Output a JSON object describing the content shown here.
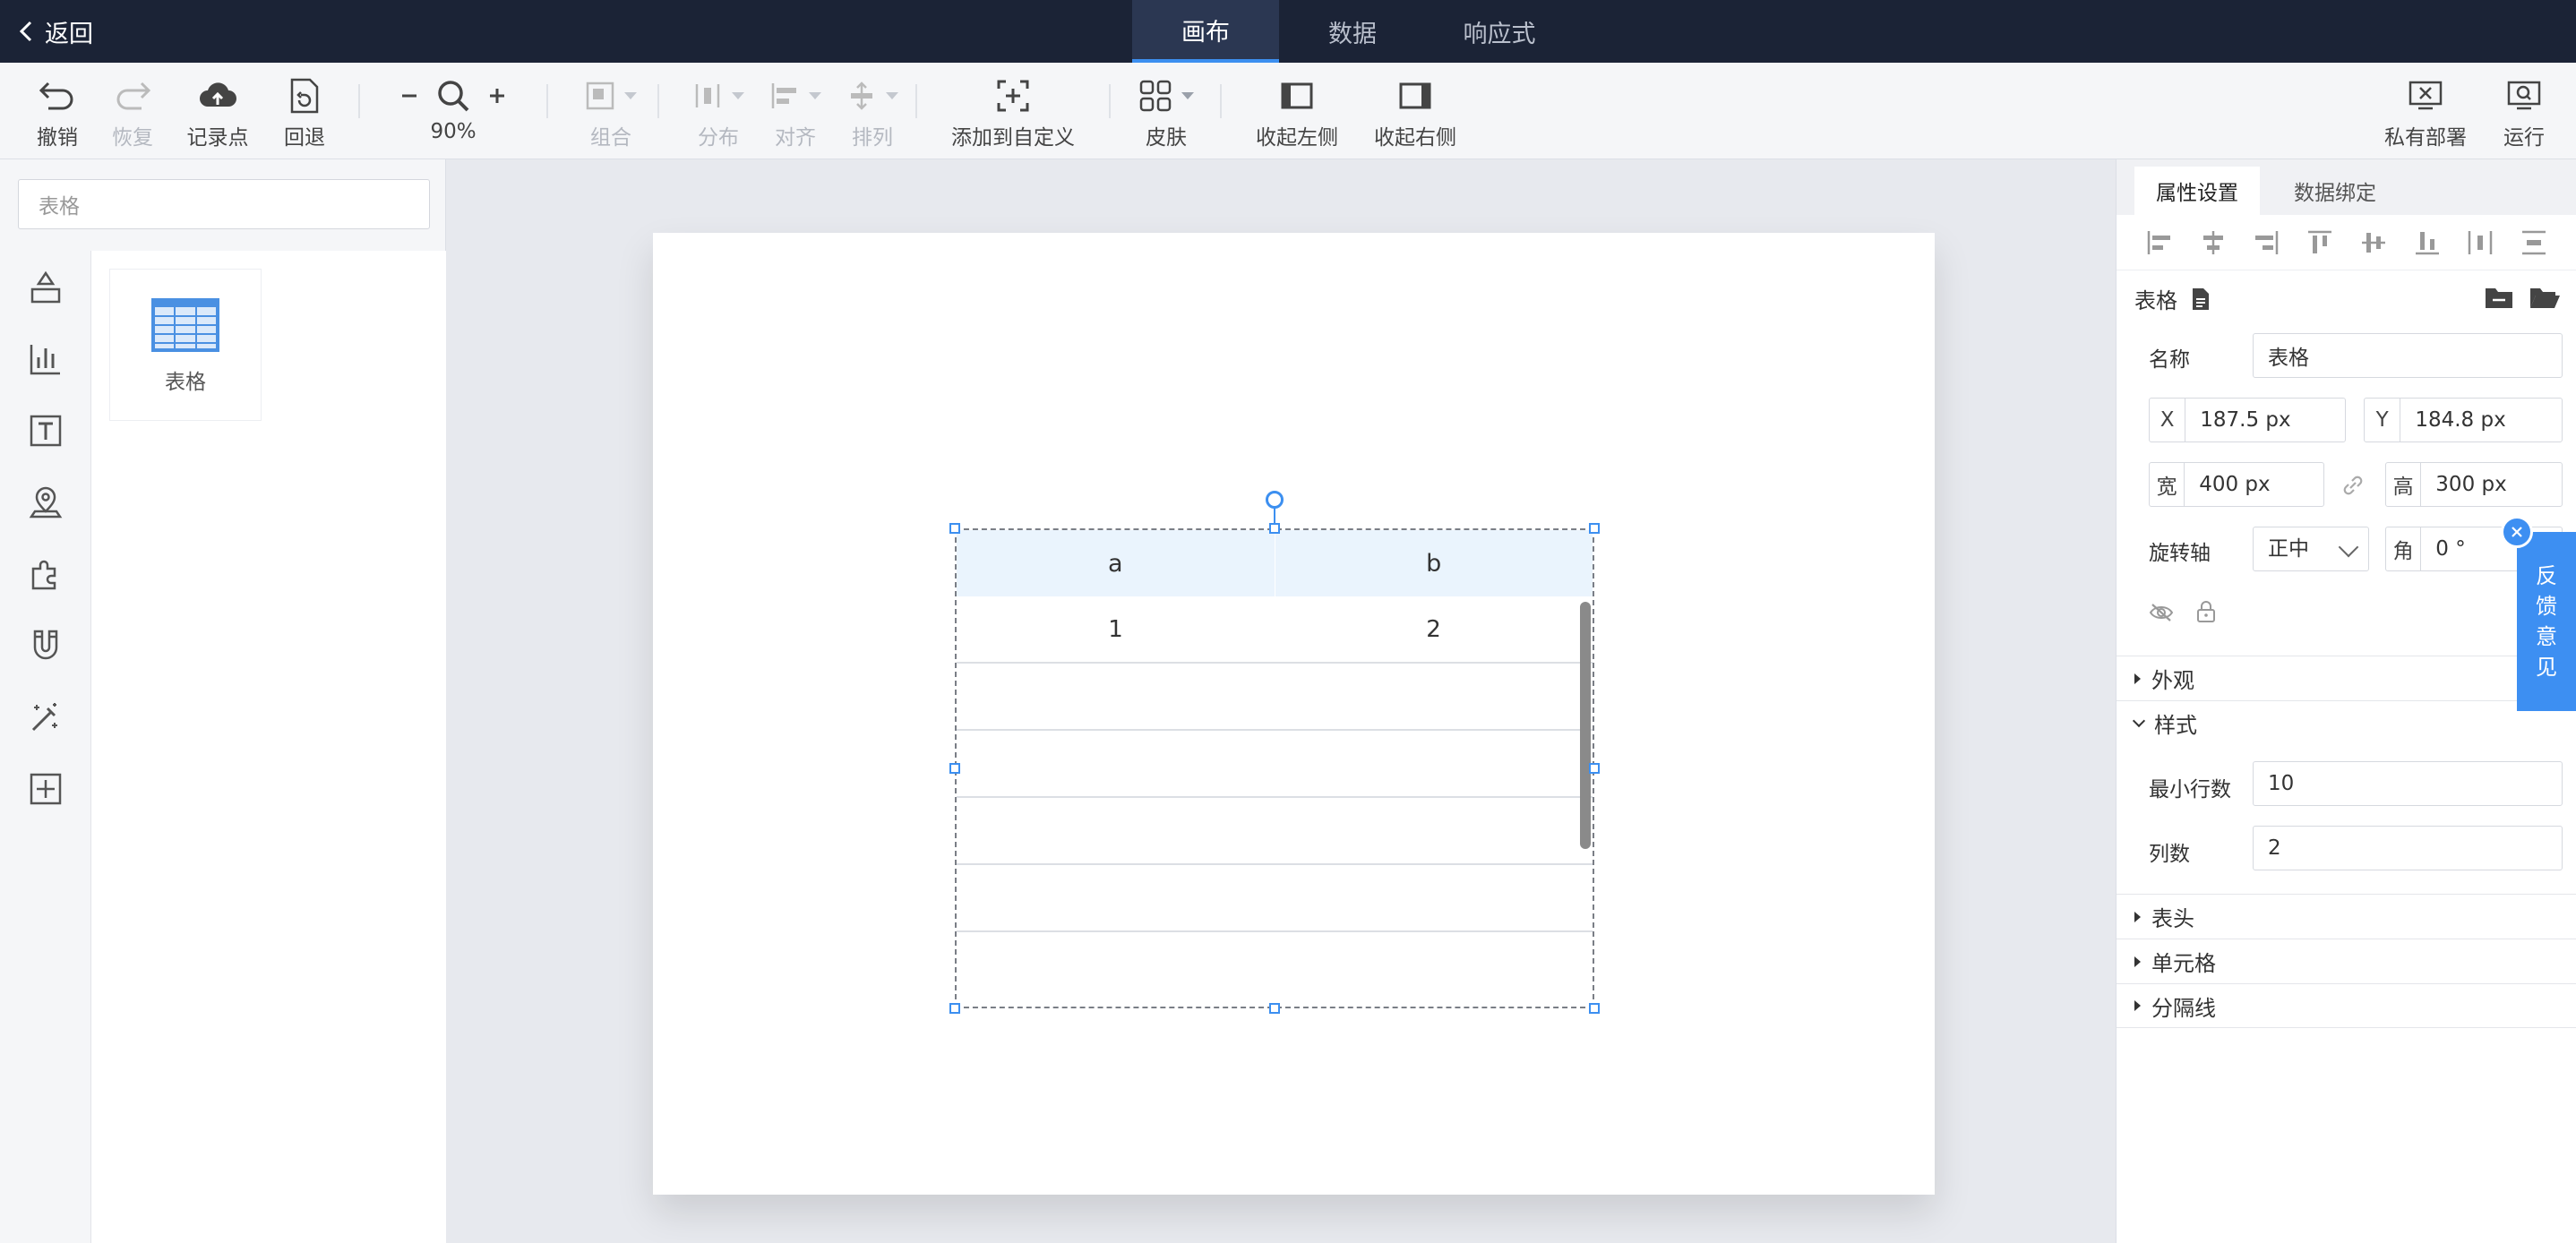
{
  "topbar": {
    "back_label": "返回",
    "tabs": [
      {
        "label": "画布",
        "active": true
      },
      {
        "label": "数据",
        "active": false
      },
      {
        "label": "响应式",
        "active": false
      }
    ]
  },
  "toolbar": {
    "undo": "撤销",
    "redo": "恢复",
    "record_point": "记录点",
    "rollback": "回退",
    "zoom": "90%",
    "group": "组合",
    "distribute": "分布",
    "align": "对齐",
    "arrange": "排列",
    "add_custom": "添加到自定义",
    "skin": "皮肤",
    "collapse_left": "收起左侧",
    "collapse_right": "收起右侧",
    "private_deploy": "私有部署",
    "run": "运行"
  },
  "left": {
    "search_value": "表格",
    "components": [
      {
        "label": "表格",
        "icon": "table-icon"
      }
    ],
    "rail_icons": [
      "shapes-icon",
      "bar-chart-icon",
      "text-icon",
      "map-pin-icon",
      "puzzle-icon",
      "magnet-icon",
      "magic-wand-icon",
      "add-frame-icon"
    ]
  },
  "canvas": {
    "table": {
      "headers": [
        "a",
        "b"
      ],
      "rows": [
        [
          "1",
          "2"
        ],
        [
          "",
          ""
        ],
        [
          "",
          ""
        ],
        [
          "",
          ""
        ],
        [
          "",
          ""
        ],
        [
          "",
          ""
        ]
      ]
    }
  },
  "right": {
    "tabs": [
      "属性设置",
      "数据绑定"
    ],
    "component_title": "表格",
    "name_label": "名称",
    "name_value": "表格",
    "x_label": "X",
    "x_value": "187.5 px",
    "y_label": "Y",
    "y_value": "184.8 px",
    "w_label": "宽",
    "w_value": "400 px",
    "h_label": "高",
    "h_value": "300 px",
    "rotation_axis_label": "旋转轴",
    "rotation_axis_value": "正中",
    "angle_label": "角",
    "angle_value": "0 °",
    "groups": {
      "appearance": "外观",
      "style": "样式",
      "header": "表头",
      "cell": "单元格",
      "divider": "分隔线"
    },
    "min_rows_label": "最小行数",
    "min_rows_value": "10",
    "cols_label": "列数",
    "cols_value": "2"
  },
  "feedback": {
    "chars": [
      "反",
      "馈",
      "意",
      "见"
    ]
  },
  "colors": {
    "accent": "#3c8ff0",
    "topbar": "#1b2336",
    "table_header_bg": "#eaf4fd"
  }
}
